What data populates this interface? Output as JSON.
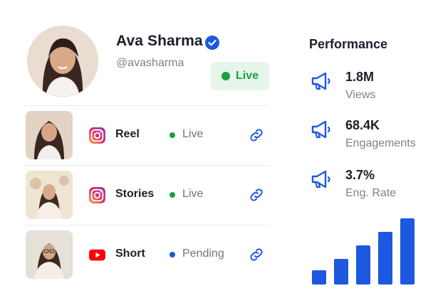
{
  "profile": {
    "name": "Ava Sharma",
    "handle": "@avasharma",
    "status_label": "Live",
    "status_color": "#1c9e43"
  },
  "content_rows": [
    {
      "platform": "instagram-icon",
      "type": "Reel",
      "status": "Live",
      "status_color": "#1c9e43"
    },
    {
      "platform": "instagram-icon",
      "type": "Stories",
      "status": "Live",
      "status_color": "#1c9e43"
    },
    {
      "platform": "youtube-icon",
      "type": "Short",
      "status": "Pending",
      "status_color": "#1a5ad8"
    }
  ],
  "performance": {
    "title": "Performance",
    "metrics": [
      {
        "icon": "megaphone-icon",
        "value": "1.8M",
        "label": "Views"
      },
      {
        "icon": "megaphone-icon",
        "value": "68.4K",
        "label": "Engagements"
      },
      {
        "icon": "megaphone-icon",
        "value": "3.7%",
        "label": "Eng. Rate"
      }
    ]
  },
  "chart_data": {
    "type": "bar",
    "values": [
      20,
      36,
      55,
      74,
      93
    ],
    "ylim": [
      0,
      100
    ],
    "color": "#1c58e0"
  },
  "accent_color": "#1c58e0"
}
